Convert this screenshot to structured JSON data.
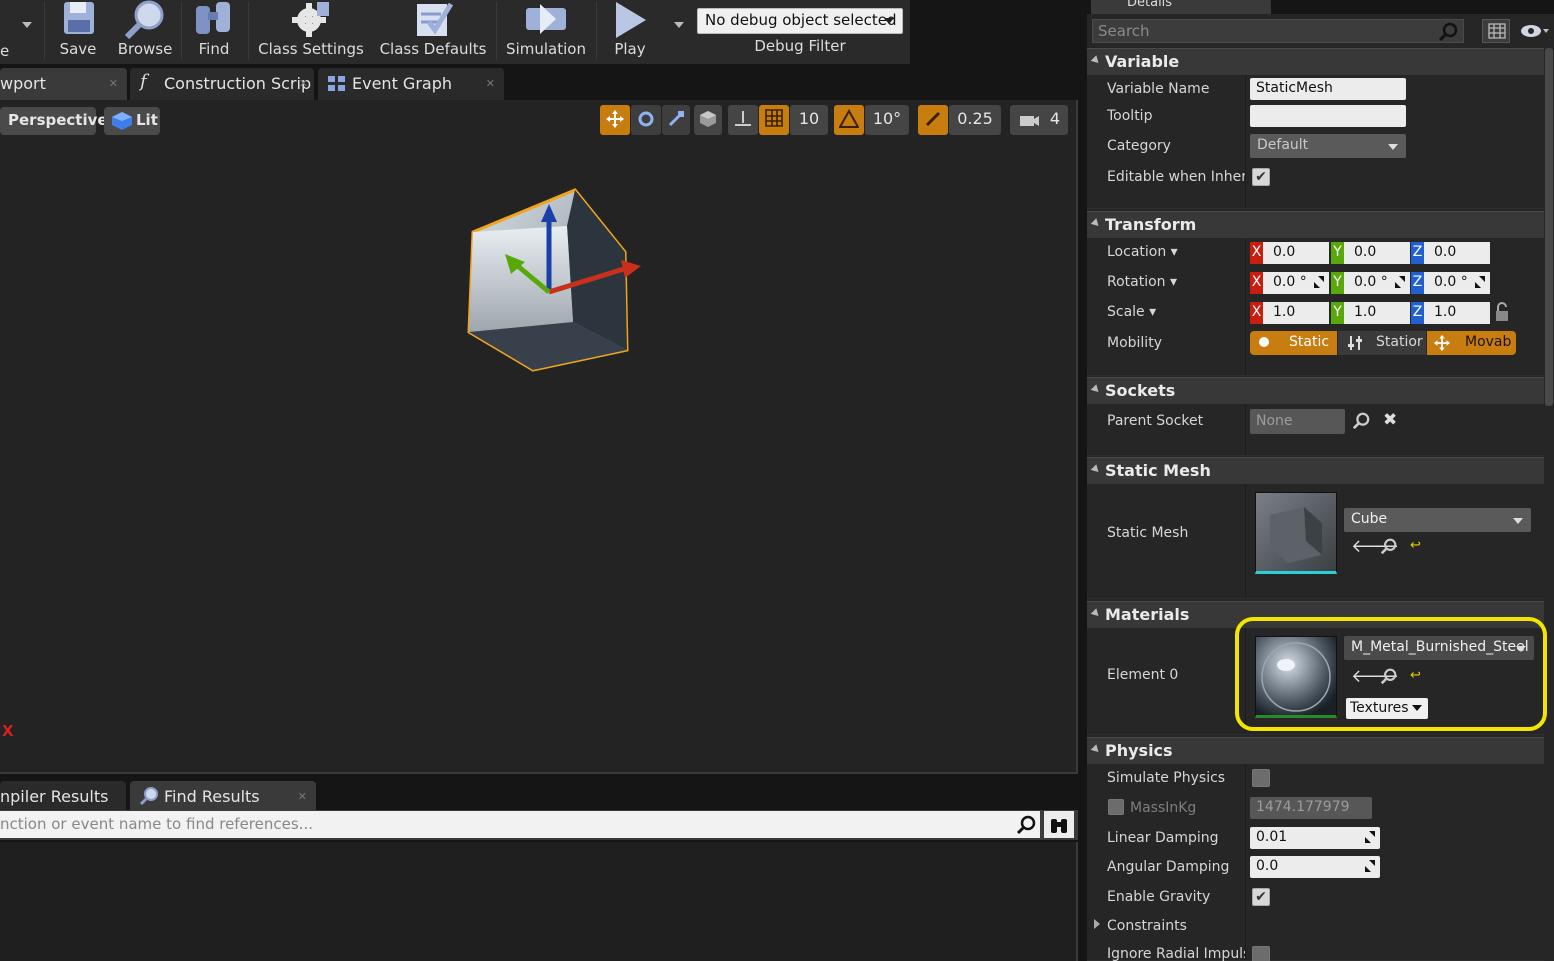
{
  "toolbar": {
    "save": "Save",
    "browse": "Browse",
    "find": "Find",
    "class_settings": "Class Settings",
    "class_defaults": "Class Defaults",
    "simulation": "Simulation",
    "play": "Play",
    "debug_select": "No debug object selected",
    "debug_filter": "Debug Filter"
  },
  "editor_tabs": [
    {
      "label": "wport"
    },
    {
      "label": "Construction Scrip"
    },
    {
      "label": "Event Graph"
    }
  ],
  "viewport": {
    "perspective": "Perspective",
    "lit": "Lit",
    "grid_snap": "10",
    "rot_snap": "10°",
    "scale_snap": "0.25",
    "cam_speed": "4",
    "axis_label": "X"
  },
  "bottom": {
    "tabs": [
      {
        "label": "npiler Results"
      },
      {
        "label": "Find Results"
      }
    ],
    "find_placeholder": "nction or event name to find references..."
  },
  "details": {
    "tab": "Details",
    "search_placeholder": "Search",
    "categories": {
      "variable": "Variable",
      "transform": "Transform",
      "sockets": "Sockets",
      "static_mesh": "Static Mesh",
      "materials": "Materials",
      "physics": "Physics"
    },
    "variable": {
      "name_label": "Variable Name",
      "name_value": "StaticMesh",
      "tooltip_label": "Tooltip",
      "tooltip_value": "",
      "category_label": "Category",
      "category_value": "Default",
      "editable_label": "Editable when Inherit",
      "editable_checked": true
    },
    "transform": {
      "location_label": "Location",
      "rotation_label": "Rotation",
      "scale_label": "Scale",
      "mobility_label": "Mobility",
      "location": {
        "x": "0.0",
        "y": "0.0",
        "z": "0.0"
      },
      "rotation": {
        "x": "0.0 °",
        "y": "0.0 °",
        "z": "0.0 °"
      },
      "scale": {
        "x": "1.0",
        "y": "1.0",
        "z": "1.0"
      },
      "axis": {
        "x": "X",
        "y": "Y",
        "z": "Z"
      },
      "mobility": {
        "static": "Static",
        "stationary": "Statior",
        "movable": "Movab"
      }
    },
    "sockets": {
      "parent_label": "Parent Socket",
      "parent_value": "None"
    },
    "static_mesh": {
      "label": "Static Mesh",
      "value": "Cube"
    },
    "materials": {
      "element_label": "Element 0",
      "value": "M_Metal_Burnished_Steel",
      "textures": "Textures"
    },
    "physics": {
      "simulate_label": "Simulate Physics",
      "mass_label": "MassInKg",
      "mass_value": "1474.177979",
      "linear_label": "Linear Damping",
      "linear_value": "0.01",
      "angular_label": "Angular Damping",
      "angular_value": "0.0",
      "gravity_label": "Enable Gravity",
      "constraints_label": "Constraints",
      "ignore_label": "Ignore Radial Impulse"
    }
  },
  "colors": {
    "accent_orange": "#c77d10",
    "highlight": "#f2e600",
    "axis_x": "#c81e10",
    "axis_y": "#58a80c",
    "axis_z": "#2060d0"
  }
}
